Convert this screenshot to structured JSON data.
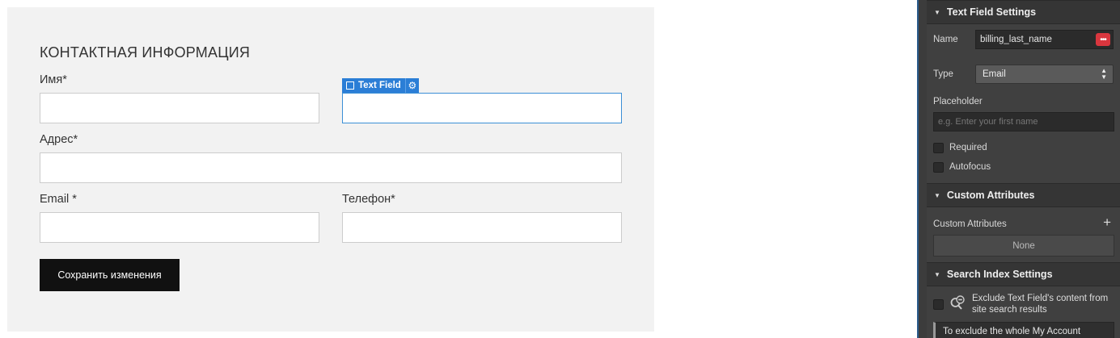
{
  "form": {
    "title": "КОНТАКТНАЯ ИНФОРМАЦИЯ",
    "fields": {
      "first_name_label": "Имя*",
      "address_label": "Адрес*",
      "email_label": "Email *",
      "phone_label": "Телефон*"
    },
    "selected_tag": {
      "label": "Text Field",
      "gear_icon": "⚙"
    },
    "save_label": "Сохранить изменения"
  },
  "panel": {
    "text_field_settings": {
      "title": "Text Field Settings",
      "name_label": "Name",
      "name_value": "billing_last_name",
      "name_more_icon": "•••",
      "type_label": "Type",
      "type_value": "Email",
      "placeholder_label": "Placeholder",
      "placeholder_hint": "e.g. Enter your first name",
      "required_label": "Required",
      "autofocus_label": "Autofocus"
    },
    "custom_attributes": {
      "title": "Custom Attributes",
      "label": "Custom Attributes",
      "add_icon": "+",
      "none_text": "None"
    },
    "search_index": {
      "title": "Search Index Settings",
      "exclude_text": "Exclude Text Field's content from site search results",
      "note_text": "To exclude the whole My Account"
    }
  },
  "colors": {
    "accent": "#2b7ed6",
    "danger": "#d9363e",
    "panel_bg": "#404040",
    "button_bg": "#111111"
  }
}
